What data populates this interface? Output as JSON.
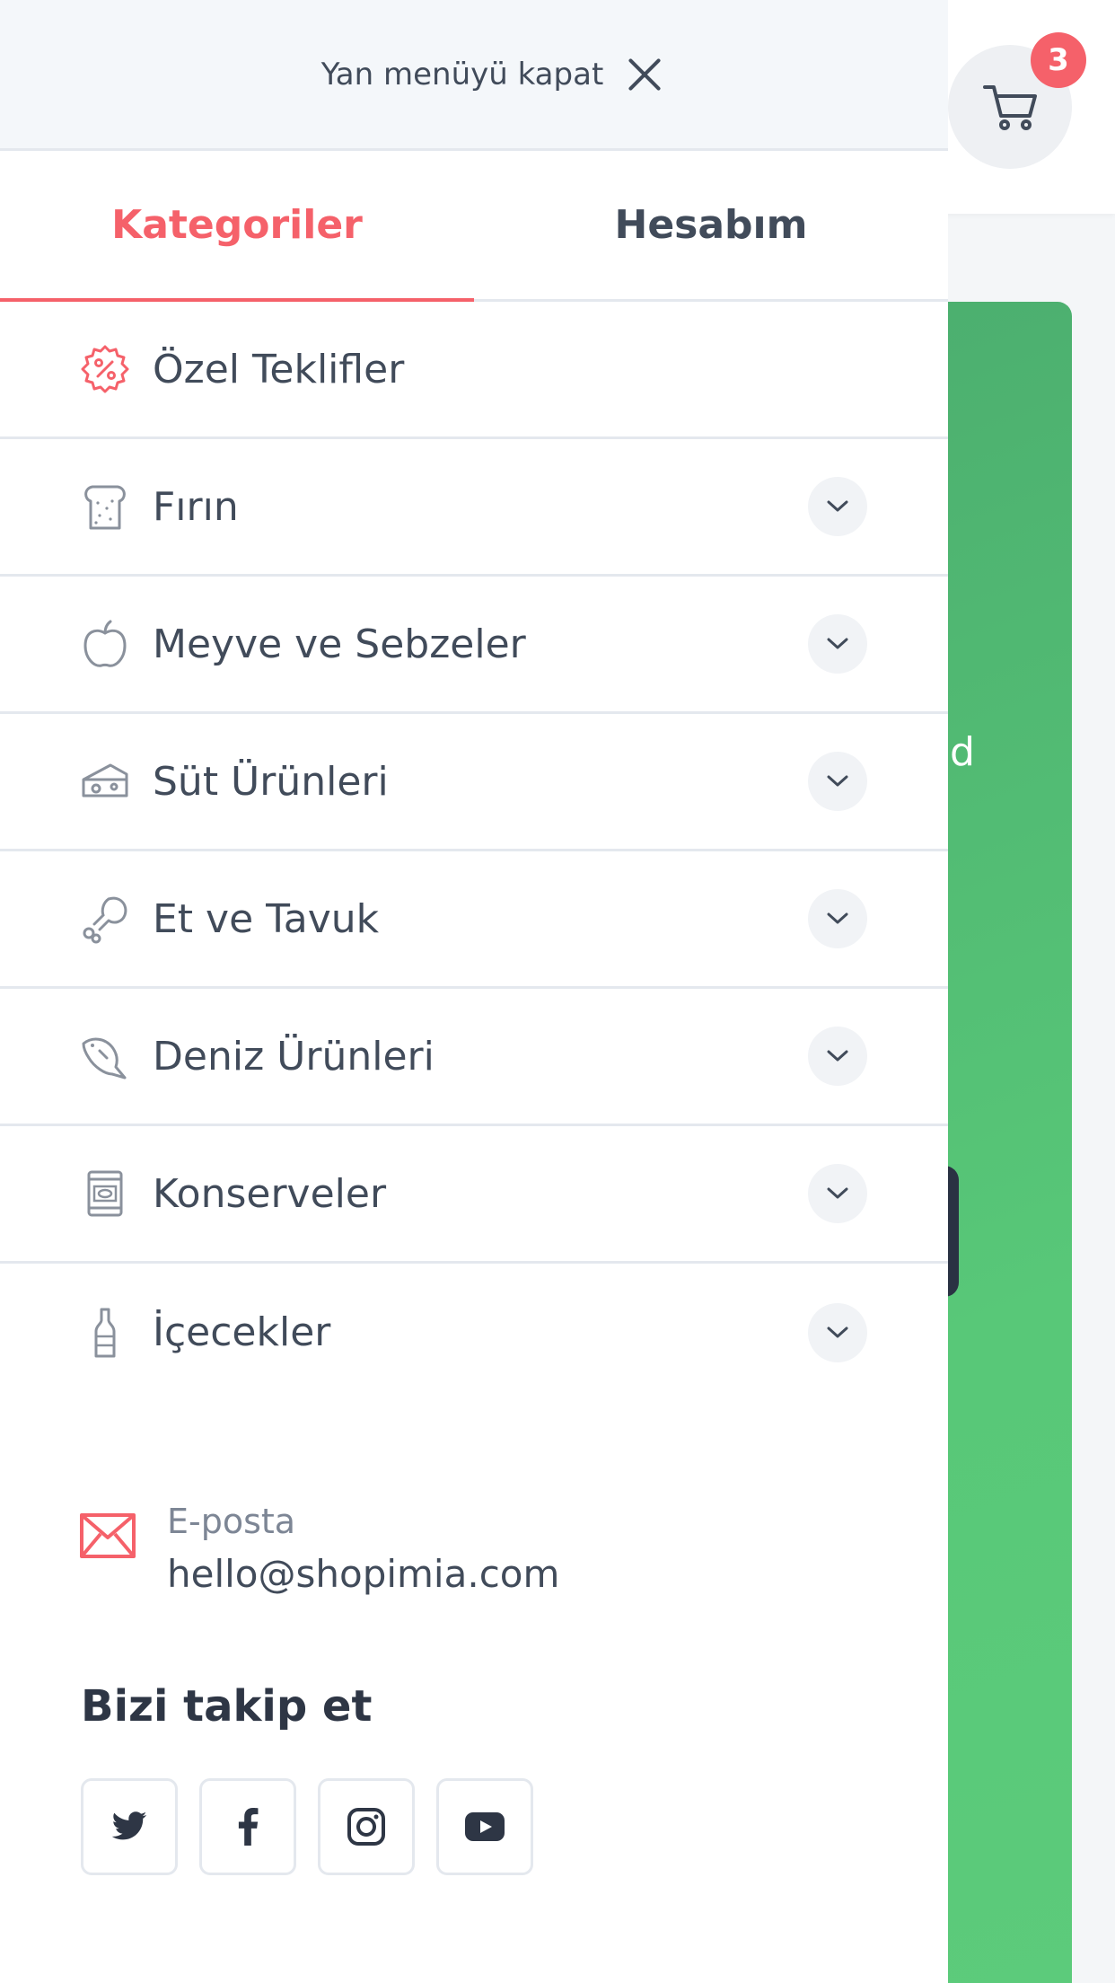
{
  "header": {
    "cart_count": "3"
  },
  "hero": {
    "partial_text": "d"
  },
  "drawer": {
    "close_label": "Yan menüyü kapat",
    "tabs": [
      {
        "label": "Kategoriler",
        "active": true
      },
      {
        "label": "Hesabım",
        "active": false
      }
    ],
    "categories": [
      {
        "label": "Özel Teklifler",
        "icon": "percent-badge-icon",
        "expandable": false
      },
      {
        "label": "Fırın",
        "icon": "bread-icon",
        "expandable": true
      },
      {
        "label": "Meyve ve Sebzeler",
        "icon": "apple-icon",
        "expandable": true
      },
      {
        "label": "Süt Ürünleri",
        "icon": "cheese-icon",
        "expandable": true
      },
      {
        "label": "Et ve Tavuk",
        "icon": "drumstick-icon",
        "expandable": true
      },
      {
        "label": "Deniz Ürünleri",
        "icon": "fish-icon",
        "expandable": true
      },
      {
        "label": "Konserveler",
        "icon": "can-icon",
        "expandable": true
      },
      {
        "label": "İçecekler",
        "icon": "bottle-icon",
        "expandable": true
      }
    ],
    "contact": {
      "label": "E-posta",
      "value": "hello@shopimia.com"
    },
    "follow": {
      "title": "Bizi takip et",
      "socials": [
        "twitter-icon",
        "facebook-icon",
        "instagram-icon",
        "youtube-icon"
      ]
    }
  },
  "colors": {
    "accent": "#f5616a",
    "text": "#414b5a",
    "hero_green": "#58c878"
  }
}
